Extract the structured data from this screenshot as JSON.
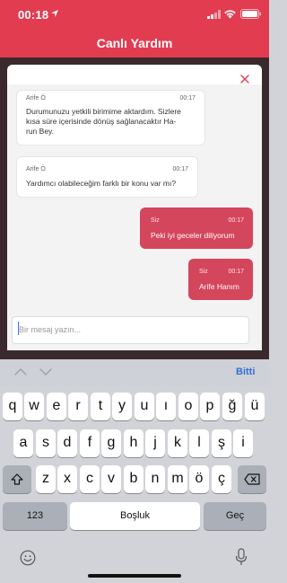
{
  "status": {
    "time": "00:18"
  },
  "header": {
    "title": "Canlı Yardım"
  },
  "messages": [
    {
      "sender": "Arife Ö",
      "time": "00:17",
      "lines": [
        "Durumunuzu yetkili birimime aktardım. Sizlere",
        "kısa süre içerisinde dönüş sağlanacaktır Ha-",
        "run Bey."
      ]
    },
    {
      "sender": "Arife Ö",
      "time": "00:17",
      "lines": [
        "Yardımcı olabileceğim farklı bir konu var mı?"
      ]
    },
    {
      "sender": "Siz",
      "time": "00:17",
      "lines": [
        "Peki iyi geceler diliyorum"
      ]
    },
    {
      "sender": "Siz",
      "time": "00:17",
      "lines": [
        "Arife Hanım"
      ]
    }
  ],
  "composer": {
    "placeholder": "Bir mesaj yazın..."
  },
  "keyboard": {
    "done_label": "Bitti",
    "row1": [
      "q",
      "w",
      "e",
      "r",
      "t",
      "y",
      "u",
      "ı",
      "o",
      "p",
      "ğ",
      "ü"
    ],
    "row2": [
      "a",
      "s",
      "d",
      "f",
      "g",
      "h",
      "j",
      "k",
      "l",
      "ş",
      "i"
    ],
    "row3": [
      "z",
      "x",
      "c",
      "v",
      "b",
      "n",
      "m",
      "ö",
      "ç"
    ],
    "numbers_label": "123",
    "space_label": "Boşluk",
    "return_label": "Geç"
  },
  "colors": {
    "accent": "#e23c51",
    "bubble_out": "#d4465c",
    "link": "#2f6fd6"
  }
}
